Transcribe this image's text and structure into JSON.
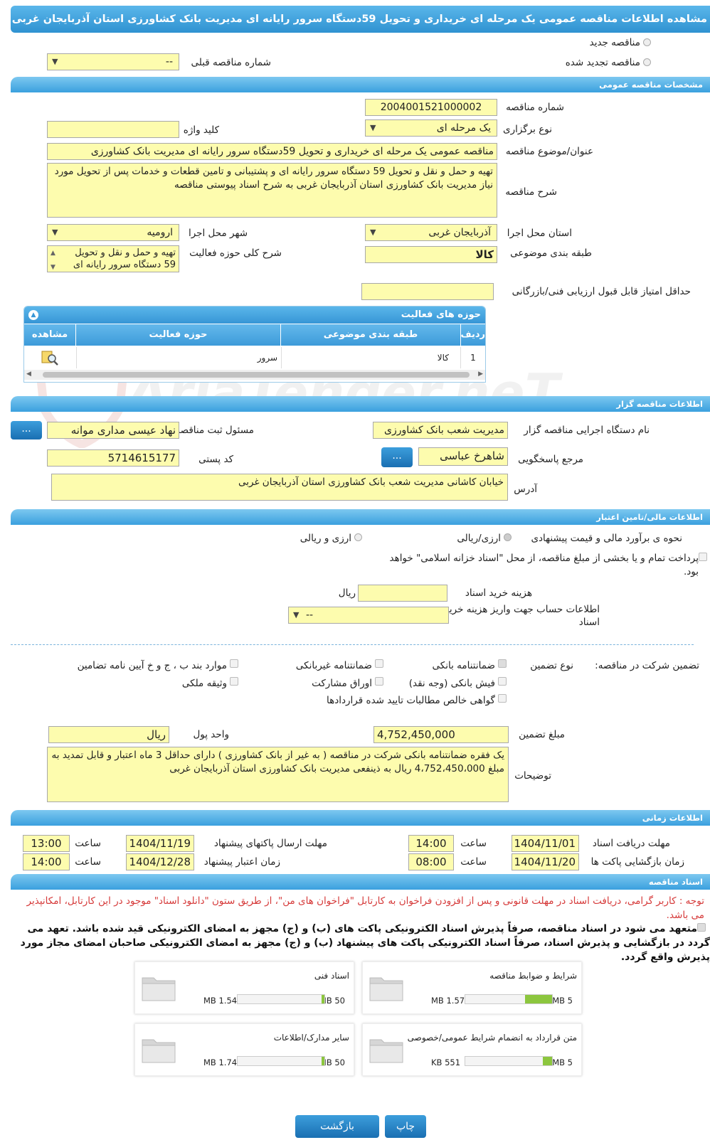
{
  "title": "مشاهده اطلاعات مناقصه عمومی یک مرحله ای خریداری و تحویل 59دستگاه سرور رایانه ای مدیریت بانک کشاورزی استان آذربایجان غربی",
  "top": {
    "new_tender": "مناقصه جدید",
    "renewed_tender": "مناقصه تجدید شده",
    "prev_number_label": "شماره مناقصه قبلی",
    "prev_number_value": "--"
  },
  "general": {
    "header": "مشخصات مناقصه عمومی",
    "number_label": "شماره مناقصه",
    "number_value": "2004001521000002",
    "type_label": "نوع برگزاری",
    "type_value": "یک مرحله ای",
    "keyword_label": "کلید واژه",
    "keyword_value": "",
    "subject_label": "عنوان/موضوع مناقصه",
    "subject_value": "مناقصه عمومی یک مرحله ای خریداری و تحویل 59دستگاه سرور رایانه ای مدیریت بانک کشاورزی",
    "desc_label": "شرح مناقصه",
    "desc_value": "تهیه و حمل و نقل و تحویل 59 دستگاه سرور رایانه ای و پشتیبانی و تامین قطعات و خدمات پس از تحویل مورد نیاز مدیریت  بانک کشاورزی استان آذربایجان غربی به شرح اسناد پیوستی مناقصه",
    "province_label": "استان محل اجرا",
    "province_value": "آذربایجان غربی",
    "city_label": "شهر محل اجرا",
    "city_value": "ارومیه",
    "category_label": "طبقه بندی موضوعی",
    "category_value": "کالا",
    "scope_label": "شرح کلی حوزه فعالیت",
    "scope_value": "تهیه و حمل و نقل و تحویل 59 دستگاه سرور رایانه ای",
    "min_score_label": "حداقل امتیاز قابل قبول ارزیابی فنی/بازرگانی",
    "min_score_value": ""
  },
  "activity_grid": {
    "header": "حوزه های فعالیت",
    "columns": [
      "ردیف",
      "طبقه بندی موضوعی",
      "حوزه فعالیت",
      "مشاهده"
    ],
    "rows": [
      {
        "index": "1",
        "category": "کالا",
        "scope": "سرور"
      }
    ]
  },
  "organizer": {
    "header": "اطلاعات مناقصه گزار",
    "org_label": "نام دستگاه اجرایی مناقصه گزار",
    "org_value": "مدیریت شعب بانک کشاورزی",
    "registrar_label": "مسئول ثبت مناقصه",
    "registrar_value": "نهاد عیسی مداری موانه",
    "responder_label": "مرجع پاسخگویی",
    "responder_value": "شاهرخ عباسی",
    "postal_label": "کد پستی",
    "postal_value": "5714615177",
    "address_label": "آدرس",
    "address_value": "خیابان کاشانی مدیریت شعب بانک کشاورزی استان آذربایجان غربی",
    "more_button": "..."
  },
  "finance": {
    "header": "اطلاعات مالی/تامین اعتبار",
    "estimate_label": "نحوه ی برآورد مالی و قیمت پیشنهادی",
    "opt_rial": "ارزی/ریالی",
    "opt_fx_rial": "ارزی و ریالی",
    "treasury_text": "پرداخت تمام و یا بخشی از مبلغ مناقصه، از محل \"اسناد خزانه اسلامی\" خواهد بود.",
    "doc_cost_label": "هزینه خرید اسناد",
    "doc_cost_value": "",
    "doc_cost_unit": "ریال",
    "account_label": "اطلاعات حساب جهت واریز هزینه خرید اسناد",
    "account_value": "--"
  },
  "guarantee": {
    "label": "تضمین شرکت در مناقصه:",
    "type_label": "نوع تضمین",
    "opt_bank_guarantee": "ضمانتنامه بانکی",
    "opt_nonbank_guarantee": "ضمانتنامه غیربانکی",
    "opt_clauses": "موارد بند ب ، ج و خ آیین نامه تضامین",
    "opt_cash": "فیش بانکی (وجه نقد)",
    "opt_bonds": "اوراق مشارکت",
    "opt_property": "وثیقه ملکی",
    "opt_claims": "گواهی خالص مطالبات تایید شده قراردادها",
    "amount_label": "مبلغ تضمین",
    "amount_value": "4,752,450,000",
    "currency_label": "واحد پول",
    "currency_value": "ریال",
    "notes_label": "توضیحات",
    "notes_value": "یک فقره ضمانتنامه بانکی شرکت در مناقصه ( به غیر از بانک کشاورزی ) دارای حداقل 3 ماه اعتبار و قابل تمدید به مبلغ 4،752،450،000 ریال به ذینفعی مدیریت بانک کشاورزی استان آذربایجان غربی"
  },
  "timing": {
    "header": "اطلاعات زمانی",
    "doc_deadline_label": "مهلت دریافت اسناد",
    "doc_deadline_date": "1404/11/01",
    "doc_deadline_time": "14:00",
    "submit_deadline_label": "مهلت ارسال پاکتهای پیشنهاد",
    "submit_deadline_date": "1404/11/19",
    "submit_deadline_time": "13:00",
    "opening_label": "زمان بازگشایی پاکت ها",
    "opening_date": "1404/11/20",
    "opening_time": "08:00",
    "validity_label": "زمان اعتبار پیشنهاد",
    "validity_date": "1404/12/28",
    "validity_time": "14:00",
    "time_label": "ساعت"
  },
  "documents": {
    "header": "اسناد مناقصه",
    "notice": "توجه : کاربر گرامی، دریافت اسناد در مهلت قانونی و پس از افزودن فراخوان به کارتابل \"فراخوان های من\"، از طریق ستون \"دانلود اسناد\" موجود در این کارتابل، امکانپذیر می باشد.",
    "pledge": "متعهد می شود در اسناد مناقصه، صرفاً پذیرش اسناد الکترونیکی پاکت های (ب) و (ج) مجهز به امضای الکترونیکی قید شده باشد. تعهد می گردد در بازگشایی و پذیرش اسناد، صرفاً اسناد الکترونیکی پاکت های پیشنهاد (ب) و (ج) مجهز به امضای الکترونیکی صاحبان امضای مجاز مورد پذیرش واقع گردد.",
    "files": [
      {
        "name": "شرایط و ضوابط مناقصه",
        "size": "1.57 MB",
        "max": "5 MB",
        "fill": 0.31
      },
      {
        "name": "اسناد فنی",
        "size": "1.54 MB",
        "max": "50 MB",
        "fill": 0.03
      },
      {
        "name": "متن قرارداد به انضمام شرایط عمومی/خصوصی",
        "size": "551 KB",
        "max": "5 MB",
        "fill": 0.11
      },
      {
        "name": "سایر مدارک/اطلاعات",
        "size": "1.74 MB",
        "max": "50 MB",
        "fill": 0.03
      }
    ]
  },
  "footer": {
    "print_button": "چاپ",
    "back_button": "بازگشت"
  },
  "watermark": "AriaTender.neT",
  "colors": {
    "header_blue": "#3aa0de",
    "field_yellow": "#fdfcae",
    "progress_green": "#8cc63e",
    "notice_red": "#d63a3a"
  }
}
